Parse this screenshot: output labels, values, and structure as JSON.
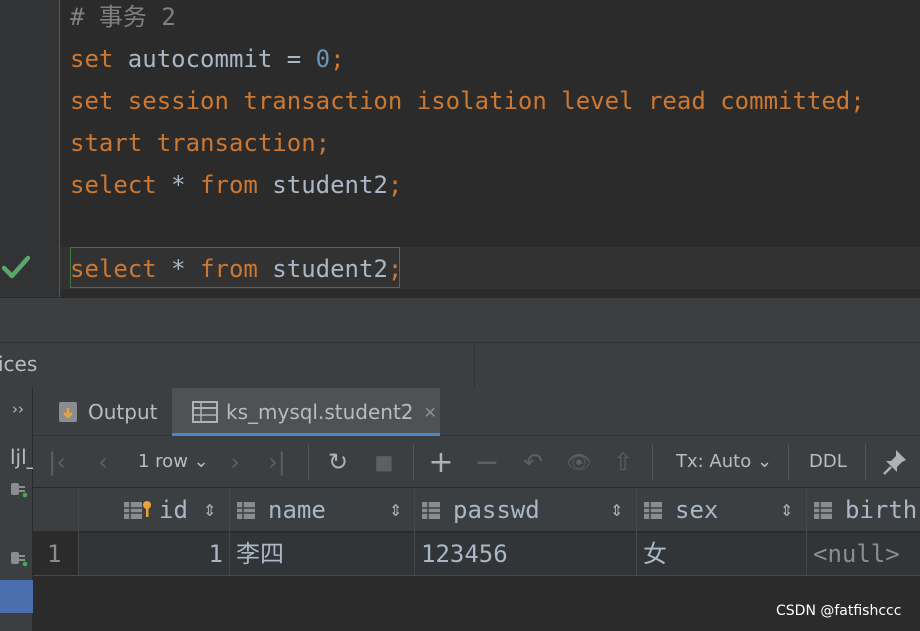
{
  "editor": {
    "lines": [
      {
        "parts": [
          {
            "t": "# 事务 2",
            "c": "cmt"
          }
        ]
      },
      {
        "parts": [
          {
            "t": "set",
            "c": "kw"
          },
          {
            "t": " autocommit = ",
            "c": ""
          },
          {
            "t": "0",
            "c": "num"
          },
          {
            "t": ";",
            "c": "kw"
          }
        ]
      },
      {
        "parts": [
          {
            "t": "set session transaction isolation level read committed;",
            "c": "kw"
          }
        ]
      },
      {
        "parts": [
          {
            "t": "start transaction;",
            "c": "kw"
          }
        ]
      },
      {
        "parts": [
          {
            "t": "select",
            "c": "kw"
          },
          {
            "t": " * ",
            "c": ""
          },
          {
            "t": "from",
            "c": "kw"
          },
          {
            "t": " student2",
            "c": ""
          },
          {
            "t": ";",
            "c": "kw"
          }
        ]
      },
      {
        "parts": []
      },
      {
        "parts": [
          {
            "t": "select",
            "c": "kw"
          },
          {
            "t": " * ",
            "c": ""
          },
          {
            "t": "from",
            "c": "kw"
          },
          {
            "t": " student2",
            "c": ""
          },
          {
            "t": ";",
            "c": "kw"
          }
        ]
      }
    ],
    "check_icon": "check-icon"
  },
  "services": {
    "title": "ices"
  },
  "left_strip": {
    "chevrons": "››",
    "label": "ljl_"
  },
  "tabs": [
    {
      "label": "Output",
      "icon": "output-icon"
    },
    {
      "label": "ks_mysql.student2",
      "icon": "table-icon",
      "close": "✕"
    }
  ],
  "toolbar": {
    "first": "|‹",
    "prev": "‹",
    "rows": "1 row",
    "rows_caret": "⌄",
    "next": "›",
    "last": "›|",
    "refresh": "↻",
    "stop": "■",
    "add": "+",
    "remove": "−",
    "revert": "↶",
    "view": "👁",
    "submit": "⇧",
    "tx": "Tx: Auto",
    "tx_caret": "⌄",
    "ddl": "DDL",
    "pin": "📌"
  },
  "grid": {
    "columns": [
      "id",
      "name",
      "passwd",
      "sex",
      "birth"
    ],
    "sort_marks": [
      "⇕",
      "⇕",
      "⇕",
      "⇕"
    ],
    "rows": [
      {
        "num": "1",
        "cells": [
          "1",
          "李四",
          "123456",
          "女",
          "<null>"
        ]
      }
    ]
  },
  "watermark": "CSDN @fatfishccc",
  "colors": {
    "keyword": "#cc7832",
    "number": "#6897bb",
    "text": "#a9b7c6",
    "accent": "#4a88c7",
    "check": "#59a869"
  }
}
